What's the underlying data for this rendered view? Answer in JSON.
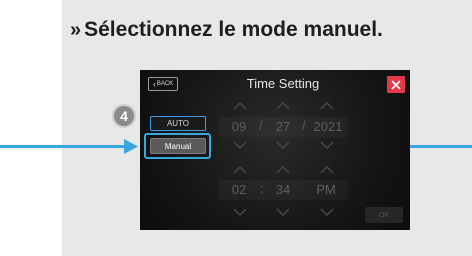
{
  "instruction": {
    "chevron": "»",
    "text": "Sélectionnez le mode manuel."
  },
  "step_badge": "4",
  "dialog": {
    "title": "Time Setting",
    "back_label": "BACK",
    "close_icon": "close-icon",
    "modes": {
      "auto_label": "AUTO",
      "manual_label": "Manual",
      "selected": "Manual"
    },
    "date": {
      "month": "09",
      "separator1": "/",
      "day": "27",
      "separator2": "/",
      "year": "2021"
    },
    "time": {
      "hour": "02",
      "separator": ":",
      "minute": "34",
      "ampm": "PM"
    },
    "ok_label": "OK"
  },
  "colors": {
    "accent": "#3aa6df",
    "close": "#e23a4a",
    "panel_bg": "#e8e8e8",
    "screen_bg": "#141414"
  }
}
